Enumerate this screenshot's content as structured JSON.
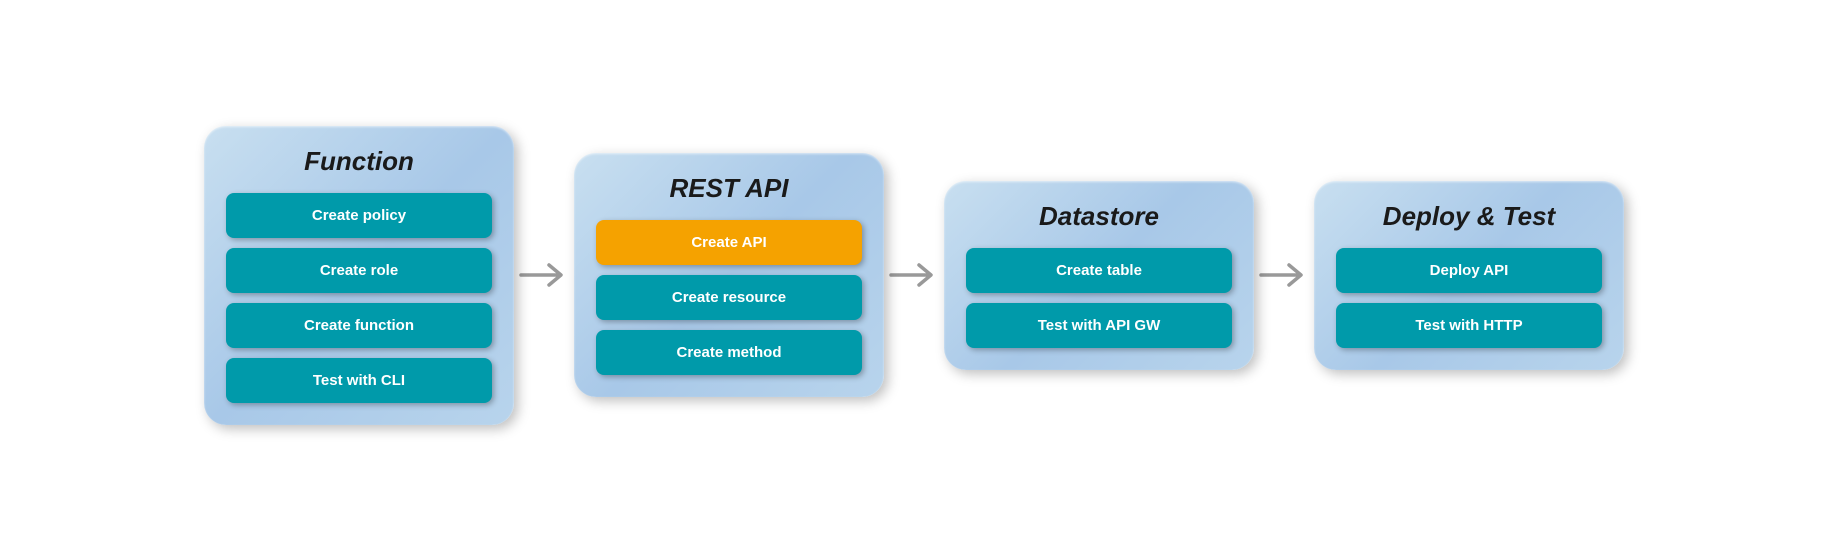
{
  "panels": [
    {
      "id": "function",
      "title": "Function",
      "items": [
        {
          "label": "Create policy",
          "active": false
        },
        {
          "label": "Create role",
          "active": false
        },
        {
          "label": "Create function",
          "active": false
        },
        {
          "label": "Test with CLI",
          "active": false
        }
      ]
    },
    {
      "id": "rest-api",
      "title": "REST API",
      "items": [
        {
          "label": "Create API",
          "active": true
        },
        {
          "label": "Create resource",
          "active": false
        },
        {
          "label": "Create method",
          "active": false
        }
      ]
    },
    {
      "id": "datastore",
      "title": "Datastore",
      "items": [
        {
          "label": "Create table",
          "active": false
        },
        {
          "label": "Test with API GW",
          "active": false
        }
      ]
    },
    {
      "id": "deploy-test",
      "title": "Deploy & Test",
      "items": [
        {
          "label": "Deploy API",
          "active": false
        },
        {
          "label": "Test with HTTP",
          "active": false
        }
      ]
    }
  ],
  "arrows": [
    {
      "id": "arrow-1"
    },
    {
      "id": "arrow-2"
    },
    {
      "id": "arrow-3"
    }
  ]
}
